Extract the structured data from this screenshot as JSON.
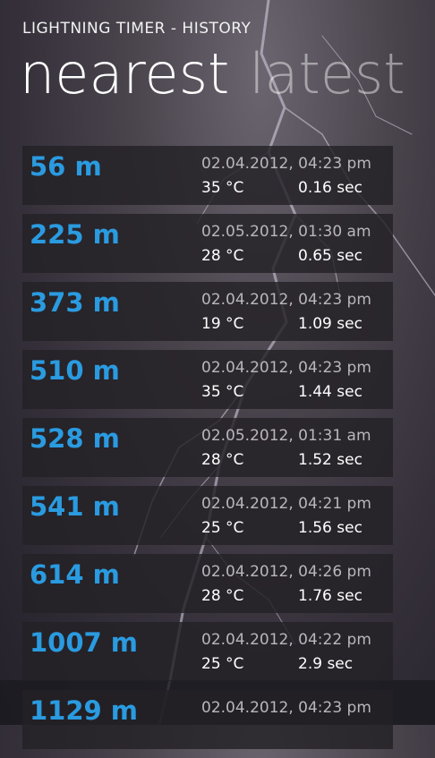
{
  "app": {
    "title": "LIGHTNING TIMER - HISTORY"
  },
  "pivot": {
    "tabs": [
      {
        "label": "nearest",
        "active": true
      },
      {
        "label": "latest",
        "active": false
      }
    ]
  },
  "history": [
    {
      "distance": "56 m",
      "datetime": "02.04.2012, 04:23 pm",
      "temperature": "35 °C",
      "delay": "0.16 sec"
    },
    {
      "distance": "225 m",
      "datetime": "02.05.2012, 01:30 am",
      "temperature": "28 °C",
      "delay": "0.65 sec"
    },
    {
      "distance": "373 m",
      "datetime": "02.04.2012, 04:23 pm",
      "temperature": "19 °C",
      "delay": "1.09 sec"
    },
    {
      "distance": "510 m",
      "datetime": "02.04.2012, 04:23 pm",
      "temperature": "35 °C",
      "delay": "1.44 sec"
    },
    {
      "distance": "528 m",
      "datetime": "02.05.2012, 01:31 am",
      "temperature": "28 °C",
      "delay": "1.52 sec"
    },
    {
      "distance": "541 m",
      "datetime": "02.04.2012, 04:21 pm",
      "temperature": "25 °C",
      "delay": "1.56 sec"
    },
    {
      "distance": "614 m",
      "datetime": "02.04.2012, 04:26 pm",
      "temperature": "28 °C",
      "delay": "1.76 sec"
    },
    {
      "distance": "1007 m",
      "datetime": "02.04.2012, 04:22 pm",
      "temperature": "25 °C",
      "delay": "2.9 sec"
    },
    {
      "distance": "1129 m",
      "datetime": "02.04.2012, 04:23 pm",
      "temperature": "",
      "delay": ""
    }
  ],
  "colors": {
    "accent": "#2a9be0",
    "background": "#3a3540"
  }
}
